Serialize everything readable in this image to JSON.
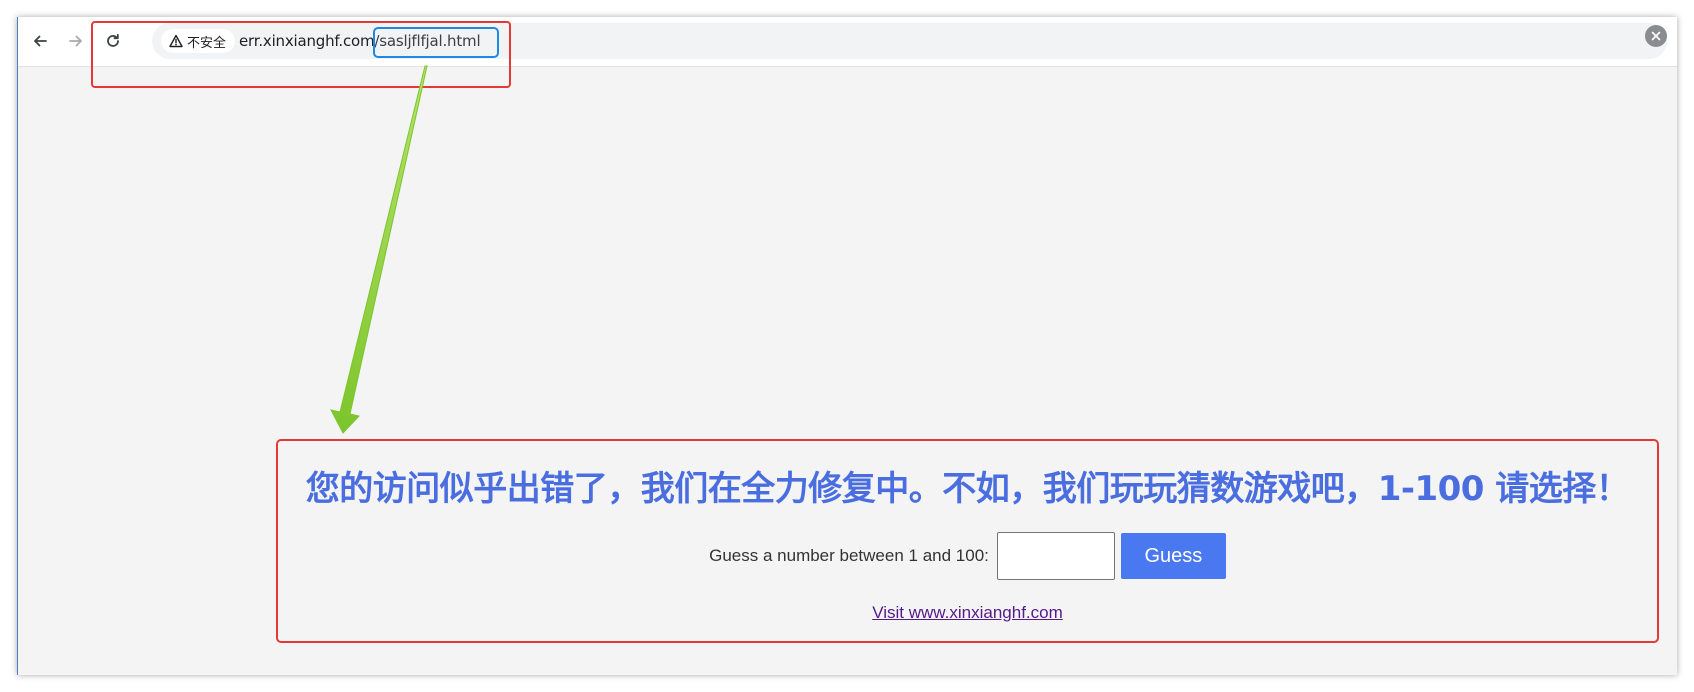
{
  "browser": {
    "security_chip": "不安全",
    "url_host": "err.xinxianghf.com",
    "url_path": "/sasljflfjal.html"
  },
  "page": {
    "headline": "您的访问似乎出错了，我们在全力修复中。不如，我们玩玩猜数游戏吧，1-100 请选择！",
    "guess_label": "Guess a number between 1 and 100:",
    "guess_input_value": "",
    "guess_button": "Guess",
    "visit_link": "Visit www.xinxianghf.com"
  },
  "colors": {
    "headline": "#4a6ee0",
    "button": "#4a78f0",
    "annotation_red": "#e53935",
    "annotation_blue": "#1e88e5",
    "arrow_green": "#8cd03c",
    "link_visited": "#551a8b"
  },
  "icons": {
    "back": "arrow-left-icon",
    "forward": "arrow-right-icon",
    "reload": "reload-icon",
    "warning": "warning-triangle-icon",
    "close": "close-icon"
  }
}
